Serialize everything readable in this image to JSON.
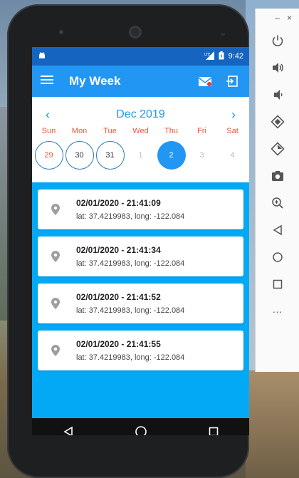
{
  "status": {
    "left_icon": "android-icon",
    "time": "9:42",
    "signal_badge": "LTE"
  },
  "appbar": {
    "title": "My Week",
    "menu_icon": "hamburger-icon",
    "actions": [
      "mail-icon",
      "exit-icon"
    ]
  },
  "calendar": {
    "month": "Dec 2019",
    "prev": "‹",
    "next": "›",
    "weekdays": [
      "Sun",
      "Mon",
      "Tue",
      "Wed",
      "Thu",
      "Fri",
      "Sat"
    ],
    "days": [
      "29",
      "30",
      "31",
      "1",
      "2",
      "3",
      "4"
    ],
    "selected_day": "2"
  },
  "entries": [
    {
      "time": "02/01/2020 - 21:41:09",
      "coords": "lat: 37.4219983, long: -122.084"
    },
    {
      "time": "02/01/2020 - 21:41:34",
      "coords": "lat: 37.4219983, long: -122.084"
    },
    {
      "time": "02/01/2020 - 21:41:52",
      "coords": "lat: 37.4219983, long: -122.084"
    },
    {
      "time": "02/01/2020 - 21:41:55",
      "coords": "lat: 37.4219983, long: -122.084"
    }
  ],
  "navbar": [
    "back-icon",
    "home-icon",
    "recents-icon"
  ],
  "toolbar": {
    "window_controls": [
      "–",
      "×"
    ],
    "buttons": [
      "power-icon",
      "volume-up-icon",
      "volume-down-icon",
      "rotate-left-icon",
      "rotate-right-icon",
      "camera-icon",
      "zoom-icon",
      "back-icon",
      "home-icon",
      "overview-icon",
      "more-icon"
    ],
    "more_label": "···"
  },
  "colors": {
    "statusbar": "#1565c0",
    "appbar": "#2196f3",
    "list_bg": "#03a9f4",
    "weekend_red": "#e55a3c"
  }
}
